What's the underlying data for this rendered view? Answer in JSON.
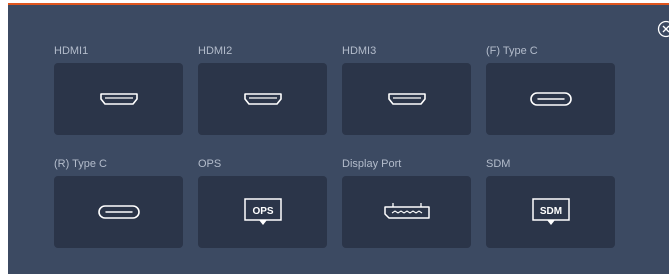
{
  "dialog": {
    "close_icon": "close-circle-icon"
  },
  "sources": [
    {
      "label": "HDMI1",
      "icon": "hdmi-port-icon"
    },
    {
      "label": "HDMI2",
      "icon": "hdmi-port-icon"
    },
    {
      "label": "HDMI3",
      "icon": "hdmi-port-icon"
    },
    {
      "label": "(F) Type C",
      "icon": "usb-c-port-icon"
    },
    {
      "label": "(R) Type C",
      "icon": "usb-c-port-icon"
    },
    {
      "label": "OPS",
      "icon": "monitor-icon",
      "icon_text": "OPS"
    },
    {
      "label": "Display Port",
      "icon": "displayport-icon"
    },
    {
      "label": "SDM",
      "icon": "monitor-icon",
      "icon_text": "SDM"
    }
  ],
  "colors": {
    "panel_bg": "#3c4a62",
    "tile_bg": "#2b3549",
    "accent_border": "#e0561f",
    "icon_stroke": "#ffffff",
    "label_text": "#b3bccb"
  }
}
